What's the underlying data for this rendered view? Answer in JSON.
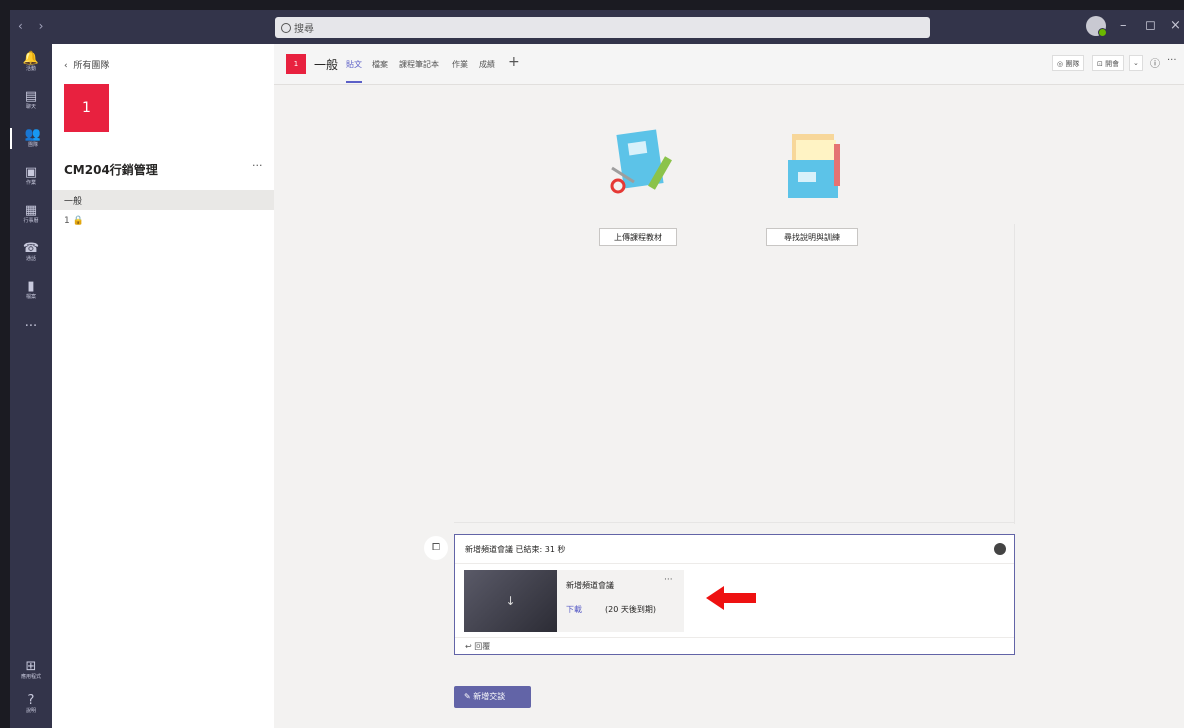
{
  "titlebar": {
    "nav_arrows": "‹ ›",
    "search_placeholder": "搜尋",
    "minimize": "–",
    "maximize": "◻",
    "close": "×"
  },
  "rail": {
    "items": [
      {
        "icon": "bell-icon",
        "glyph": "🔔",
        "label": "活動"
      },
      {
        "icon": "chat-icon",
        "glyph": "▤",
        "label": "聊天"
      },
      {
        "icon": "teams-icon",
        "glyph": "👥",
        "label": "團隊"
      },
      {
        "icon": "assignments-icon",
        "glyph": "▣",
        "label": "作業"
      },
      {
        "icon": "calendar-icon",
        "glyph": "▦",
        "label": "行事曆"
      },
      {
        "icon": "phone-icon",
        "glyph": "☎",
        "label": "通話"
      },
      {
        "icon": "files-icon",
        "glyph": "▮",
        "label": "檔案"
      },
      {
        "icon": "more-icon",
        "glyph": "···",
        "label": ""
      }
    ],
    "bottom": [
      {
        "icon": "apps-icon",
        "glyph": "⊞",
        "label": "應用程式"
      },
      {
        "icon": "help-icon",
        "glyph": "?",
        "label": "說明"
      }
    ]
  },
  "team": {
    "back_label": "所有團隊",
    "tile_text": "1",
    "name": "CM204行銷管理",
    "more": "···",
    "channel": "一般",
    "private": "1 🔒"
  },
  "channel": {
    "tile_text": "1",
    "name": "一般",
    "tabs": [
      "貼文",
      "檔案",
      "課程筆記本",
      "作業",
      "成績"
    ],
    "add_tab": "+",
    "team_btn": "◎ 團隊",
    "meet_btn": "⊡ 開會",
    "info": "ⓘ",
    "more": "···"
  },
  "welcome": {
    "upload_btn": "上傳課程教材",
    "help_btn": "尋找說明與訓練"
  },
  "meeting": {
    "cam_icon": "⧠",
    "header": "新增頻道會議 已結束: 31 秒",
    "recording_title": "新增頻道會議",
    "recording_more": "···",
    "download": "下載",
    "expires": "(20 天後到期)",
    "thumb_glyph": "↓",
    "reply": "↩ 回覆"
  },
  "compose": {
    "new_conversation": "✎  新增交談"
  },
  "colors": {
    "rail_bg": "#33344a",
    "accent": "#6264a7",
    "team_tile": "#e8213f",
    "annotation_arrow": "#ee1111"
  }
}
